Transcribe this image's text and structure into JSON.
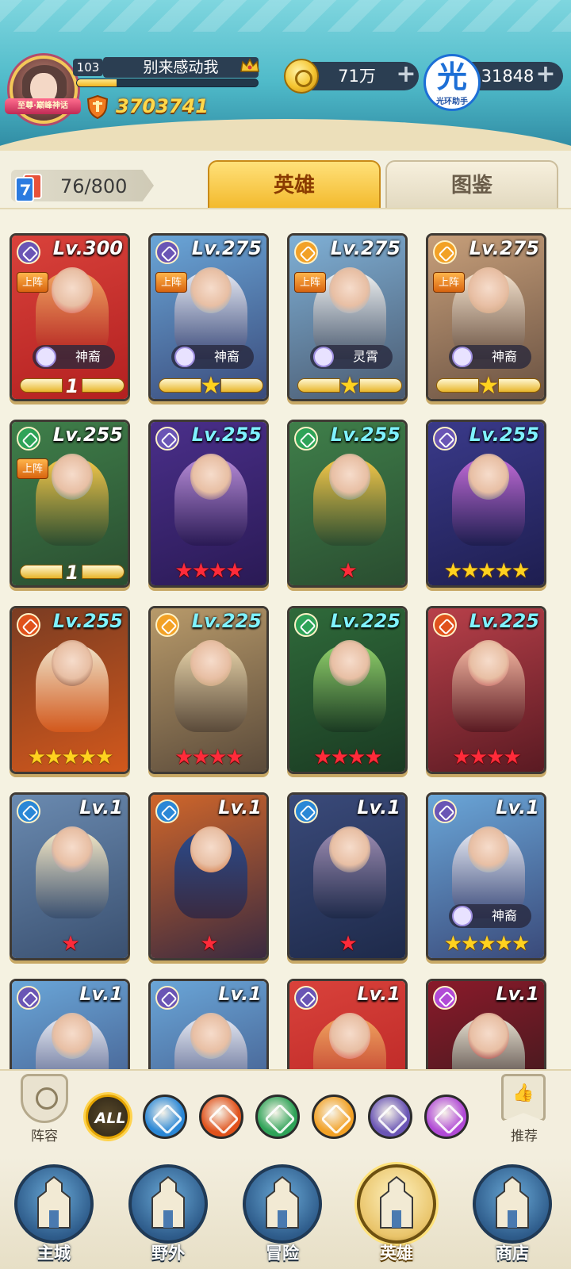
{
  "player": {
    "level": "103",
    "name": "别来感动我",
    "title_ribbon": "至尊·巅峰神话",
    "power": "3703741",
    "exp_fraction": 0.22
  },
  "currency": {
    "gold": "71万",
    "gems": "31848"
  },
  "helper": {
    "char": "光",
    "label": "光环助手"
  },
  "roster": {
    "count": "76/800"
  },
  "tabs": {
    "heroes": "英雄",
    "codex": "图鉴"
  },
  "deploy_label": "上阵",
  "colors": {
    "element_light": "#f2a126",
    "element_dark": "#6a55b5",
    "element_nature": "#2fa358",
    "element_water": "#2a87d6",
    "element_fire": "#e0521c",
    "element_chaos": "#b14ad6"
  },
  "heroes": [
    {
      "level": "Lv.300",
      "element": "dark",
      "deployed": true,
      "faction": "神裔",
      "wings": "1",
      "stars": 0,
      "star_color": "",
      "art": [
        "#d9423b",
        "#f0a35f",
        "#b32020"
      ],
      "lv_cyan": false
    },
    {
      "level": "Lv.275",
      "element": "dark",
      "deployed": true,
      "faction": "神裔",
      "wings": "★",
      "stars": 0,
      "star_color": "",
      "art": [
        "#6aa6d8",
        "#e5e8f2",
        "#3a4a7a"
      ],
      "lv_cyan": false
    },
    {
      "level": "Lv.275",
      "element": "light",
      "deployed": true,
      "faction": "灵霄",
      "wings": "★",
      "stars": 0,
      "star_color": "",
      "art": [
        "#7fb0d6",
        "#eef0f0",
        "#4a5a70"
      ],
      "lv_cyan": false
    },
    {
      "level": "Lv.275",
      "element": "light",
      "deployed": true,
      "faction": "神裔",
      "wings": "★",
      "stars": 0,
      "star_color": "",
      "art": [
        "#c79f7a",
        "#f3e1cc",
        "#6a5242"
      ],
      "lv_cyan": false
    },
    {
      "level": "Lv.255",
      "element": "nature",
      "deployed": true,
      "faction": "",
      "wings": "1",
      "stars": 0,
      "star_color": "",
      "art": [
        "#3f7f4a",
        "#f5c84a",
        "#2a4d30"
      ],
      "lv_cyan": false
    },
    {
      "level": "Lv.255",
      "element": "dark",
      "deployed": false,
      "faction": "",
      "wings": "",
      "stars": 4,
      "star_color": "red",
      "art": [
        "#4a2f8a",
        "#b58ad6",
        "#2a1a55"
      ],
      "lv_cyan": true
    },
    {
      "level": "Lv.255",
      "element": "nature",
      "deployed": false,
      "faction": "",
      "wings": "",
      "stars": 1,
      "star_color": "red",
      "art": [
        "#3f7f4a",
        "#f5c84a",
        "#2a4d30"
      ],
      "lv_cyan": true
    },
    {
      "level": "Lv.255",
      "element": "dark",
      "deployed": false,
      "faction": "",
      "wings": "",
      "stars": 5,
      "star_color": "gold",
      "art": [
        "#3a3a8a",
        "#c06ad6",
        "#1e1e50"
      ],
      "lv_cyan": true
    },
    {
      "level": "Lv.255",
      "element": "fire",
      "deployed": false,
      "faction": "",
      "wings": "",
      "stars": 5,
      "star_color": "gold",
      "art": [
        "#7a3c22",
        "#efe2c8",
        "#d2581c"
      ],
      "lv_cyan": true
    },
    {
      "level": "Lv.225",
      "element": "light",
      "deployed": false,
      "faction": "",
      "wings": "",
      "stars": 4,
      "star_color": "red",
      "art": [
        "#b89a6a",
        "#e6d2a8",
        "#5a4a3a"
      ],
      "lv_cyan": true
    },
    {
      "level": "Lv.225",
      "element": "nature",
      "deployed": false,
      "faction": "",
      "wings": "",
      "stars": 4,
      "star_color": "red",
      "art": [
        "#2f6a3a",
        "#8fcf6a",
        "#1a3a22"
      ],
      "lv_cyan": true
    },
    {
      "level": "Lv.225",
      "element": "fire",
      "deployed": false,
      "faction": "",
      "wings": "",
      "stars": 4,
      "star_color": "red",
      "art": [
        "#b8404a",
        "#f3b5a0",
        "#5a1a22"
      ],
      "lv_cyan": true
    },
    {
      "level": "Lv.1",
      "element": "water",
      "deployed": false,
      "faction": "",
      "wings": "",
      "stars": 1,
      "star_color": "red",
      "art": [
        "#6a8ab0",
        "#f3e7c5",
        "#3a5070"
      ],
      "lv_cyan": false
    },
    {
      "level": "Lv.1",
      "element": "water",
      "deployed": false,
      "faction": "",
      "wings": "",
      "stars": 1,
      "star_color": "red",
      "art": [
        "#d0662a",
        "#2a4a8a",
        "#3a2a40"
      ],
      "lv_cyan": false
    },
    {
      "level": "Lv.1",
      "element": "water",
      "deployed": false,
      "faction": "",
      "wings": "",
      "stars": 1,
      "star_color": "red",
      "art": [
        "#3a4a7a",
        "#9a8ab0",
        "#1e2a4a"
      ],
      "lv_cyan": false
    },
    {
      "level": "Lv.1",
      "element": "dark",
      "deployed": false,
      "faction": "神裔",
      "wings": "",
      "stars": 5,
      "star_color": "gold",
      "art": [
        "#6aa6d8",
        "#e5e8f2",
        "#3a4a7a"
      ],
      "lv_cyan": false
    },
    {
      "level": "Lv.1",
      "element": "dark",
      "deployed": false,
      "faction": "",
      "wings": "",
      "stars": 0,
      "star_color": "",
      "art": [
        "#6aa6d8",
        "#e5e8f2",
        "#3a4a7a"
      ],
      "lv_cyan": false
    },
    {
      "level": "Lv.1",
      "element": "dark",
      "deployed": false,
      "faction": "",
      "wings": "",
      "stars": 0,
      "star_color": "",
      "art": [
        "#6aa6d8",
        "#e5e8f2",
        "#3a4a7a"
      ],
      "lv_cyan": false
    },
    {
      "level": "Lv.1",
      "element": "dark",
      "deployed": false,
      "faction": "",
      "wings": "",
      "stars": 0,
      "star_color": "",
      "art": [
        "#d9423b",
        "#f0a35f",
        "#b32020"
      ],
      "lv_cyan": false
    },
    {
      "level": "Lv.1",
      "element": "chaos",
      "deployed": false,
      "faction": "",
      "wings": "",
      "stars": 0,
      "star_color": "",
      "art": [
        "#8a1a2a",
        "#e6e0d0",
        "#2a1a1a"
      ],
      "lv_cyan": false
    }
  ],
  "filters": {
    "lineup_label": "阵容",
    "recommend_label": "推荐",
    "all_label": "ALL",
    "elements": [
      "water",
      "fire",
      "nature",
      "light",
      "dark",
      "chaos"
    ]
  },
  "nav": [
    {
      "label": "主城",
      "icon": "castle-icon",
      "active": false
    },
    {
      "label": "野外",
      "icon": "portal-icon",
      "active": false
    },
    {
      "label": "冒险",
      "icon": "sword-icon",
      "active": false
    },
    {
      "label": "英雄",
      "icon": "helmet-icon",
      "active": true
    },
    {
      "label": "商店",
      "icon": "shop-icon",
      "active": false
    }
  ]
}
